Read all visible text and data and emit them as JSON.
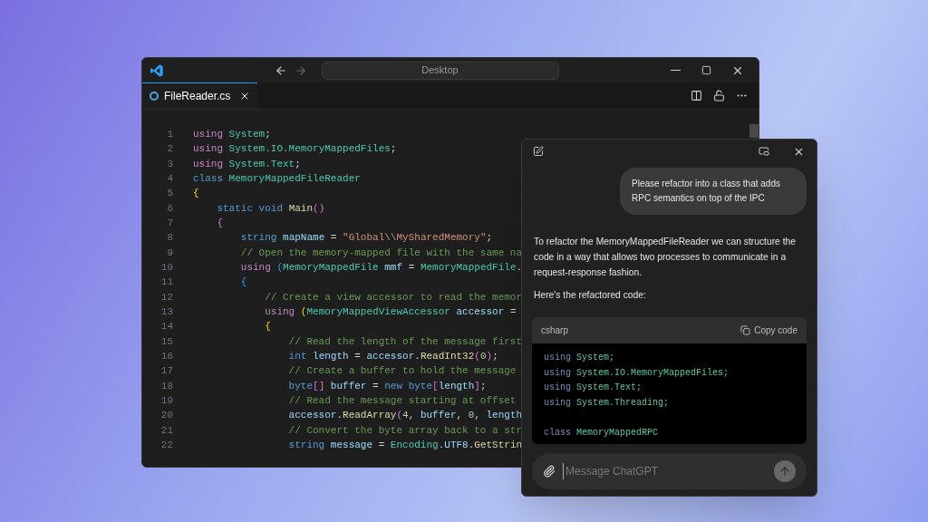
{
  "editor": {
    "title_bar": {
      "search": "Desktop",
      "back_disabled": false,
      "forward_disabled": true
    },
    "tabs": [
      {
        "label": "FileReader.cs",
        "selected": true
      }
    ],
    "code": [
      {
        "number": "1",
        "tokens": [
          {
            "text": "using ",
            "kind": "control"
          },
          {
            "text": "System",
            "kind": "type"
          },
          {
            "text": ";",
            "kind": "plain"
          }
        ]
      },
      {
        "number": "2",
        "tokens": [
          {
            "text": "using ",
            "kind": "control"
          },
          {
            "text": "System.IO.MemoryMappedFiles",
            "kind": "type"
          },
          {
            "text": ";",
            "kind": "plain"
          }
        ]
      },
      {
        "number": "3",
        "tokens": [
          {
            "text": "using ",
            "kind": "control"
          },
          {
            "text": "System.Text",
            "kind": "type"
          },
          {
            "text": ";",
            "kind": "plain"
          }
        ]
      },
      {
        "number": "4",
        "tokens": [
          {
            "text": "class ",
            "kind": "keyword"
          },
          {
            "text": "MemoryMappedFileReader",
            "kind": "type"
          }
        ]
      },
      {
        "number": "5",
        "tokens": [
          {
            "text": "{",
            "kind": "brace1"
          }
        ]
      },
      {
        "number": "6",
        "tokens": [
          {
            "text": "    static void ",
            "kind": "keyword"
          },
          {
            "text": "Main",
            "kind": "func"
          },
          {
            "text": "()",
            "kind": "brace2"
          }
        ]
      },
      {
        "number": "7",
        "tokens": [
          {
            "text": "    {",
            "kind": "brace2"
          }
        ]
      },
      {
        "number": "8",
        "tokens": [
          {
            "text": "        string ",
            "kind": "keyword"
          },
          {
            "text": "mapName",
            "kind": "var"
          },
          {
            "text": " = ",
            "kind": "plain"
          },
          {
            "text": "\"Global\\\\MySharedMemory\"",
            "kind": "string"
          },
          {
            "text": ";",
            "kind": "plain"
          }
        ]
      },
      {
        "number": "9",
        "tokens": [
          {
            "text": "        // Open the memory-mapped file with the same na",
            "kind": "comment"
          }
        ]
      },
      {
        "number": "10",
        "tokens": [
          {
            "text": "        using ",
            "kind": "control"
          },
          {
            "text": "(",
            "kind": "brace3"
          },
          {
            "text": "MemoryMappedFile ",
            "kind": "type"
          },
          {
            "text": "mmf",
            "kind": "var"
          },
          {
            "text": " = ",
            "kind": "plain"
          },
          {
            "text": "MemoryMappedFile",
            "kind": "type"
          },
          {
            "text": ".",
            "kind": "plain"
          }
        ]
      },
      {
        "number": "11",
        "tokens": [
          {
            "text": "        {",
            "kind": "brace3"
          }
        ]
      },
      {
        "number": "12",
        "tokens": [
          {
            "text": "            // Create a view accessor to read the memor",
            "kind": "comment"
          }
        ]
      },
      {
        "number": "13",
        "tokens": [
          {
            "text": "            using ",
            "kind": "control"
          },
          {
            "text": "(",
            "kind": "brace1"
          },
          {
            "text": "MemoryMappedViewAccessor ",
            "kind": "type"
          },
          {
            "text": "accessor",
            "kind": "var"
          },
          {
            "text": " =",
            "kind": "plain"
          }
        ]
      },
      {
        "number": "14",
        "tokens": [
          {
            "text": "            {",
            "kind": "brace1"
          }
        ]
      },
      {
        "number": "15",
        "tokens": [
          {
            "text": "                // Read the length of the message first",
            "kind": "comment"
          }
        ]
      },
      {
        "number": "16",
        "tokens": [
          {
            "text": "                int ",
            "kind": "keyword"
          },
          {
            "text": "length",
            "kind": "var"
          },
          {
            "text": " = ",
            "kind": "plain"
          },
          {
            "text": "accessor",
            "kind": "var"
          },
          {
            "text": ".",
            "kind": "plain"
          },
          {
            "text": "ReadInt32",
            "kind": "func"
          },
          {
            "text": "(",
            "kind": "brace2"
          },
          {
            "text": "0",
            "kind": "number"
          },
          {
            "text": ")",
            "kind": "brace2"
          },
          {
            "text": ";",
            "kind": "plain"
          }
        ]
      },
      {
        "number": "17",
        "tokens": [
          {
            "text": "                // Create a buffer to hold the message",
            "kind": "comment"
          }
        ]
      },
      {
        "number": "18",
        "tokens": [
          {
            "text": "                byte",
            "kind": "keyword"
          },
          {
            "text": "[]",
            "kind": "brace2"
          },
          {
            "text": " buffer",
            "kind": "var"
          },
          {
            "text": " = ",
            "kind": "plain"
          },
          {
            "text": "new byte",
            "kind": "keyword"
          },
          {
            "text": "[",
            "kind": "brace2"
          },
          {
            "text": "length",
            "kind": "var"
          },
          {
            "text": "]",
            "kind": "brace2"
          },
          {
            "text": ";",
            "kind": "plain"
          }
        ]
      },
      {
        "number": "19",
        "tokens": [
          {
            "text": "                // Read the message starting at offset",
            "kind": "comment"
          }
        ]
      },
      {
        "number": "20",
        "tokens": [
          {
            "text": "                accessor",
            "kind": "var"
          },
          {
            "text": ".",
            "kind": "plain"
          },
          {
            "text": "ReadArray",
            "kind": "func"
          },
          {
            "text": "(",
            "kind": "brace2"
          },
          {
            "text": "4",
            "kind": "number"
          },
          {
            "text": ", ",
            "kind": "plain"
          },
          {
            "text": "buffer",
            "kind": "var"
          },
          {
            "text": ", ",
            "kind": "plain"
          },
          {
            "text": "0",
            "kind": "number"
          },
          {
            "text": ", ",
            "kind": "plain"
          },
          {
            "text": "length",
            "kind": "var"
          }
        ]
      },
      {
        "number": "21",
        "tokens": [
          {
            "text": "                // Convert the byte array back to a str",
            "kind": "comment"
          }
        ]
      },
      {
        "number": "22",
        "tokens": [
          {
            "text": "                string ",
            "kind": "keyword"
          },
          {
            "text": "message",
            "kind": "var"
          },
          {
            "text": " = ",
            "kind": "plain"
          },
          {
            "text": "Encoding",
            "kind": "type"
          },
          {
            "text": ".",
            "kind": "plain"
          },
          {
            "text": "UTF8",
            "kind": "var"
          },
          {
            "text": ".",
            "kind": "plain"
          },
          {
            "text": "GetStrin",
            "kind": "func"
          }
        ]
      }
    ]
  },
  "chat": {
    "user_message": {
      "paragraphs": [
        "Please refactor into a class that adds RPC semantics on top of the IPC"
      ]
    },
    "assistant_message": {
      "paragraphs": [
        "To refactor the MemoryMappedFileReader we can structure the code in a way that allows two processes to communicate in a request-response fashion.",
        "Here's the refactored code:"
      ],
      "code_block": {
        "language": "csharp",
        "copy_label": "Copy code",
        "sections": [
          [
            {
              "tokens": [
                {
                  "text": "using ",
                  "kind": "keyword"
                },
                {
                  "text": "System;",
                  "kind": "type"
                }
              ]
            },
            {
              "tokens": [
                {
                  "text": "using ",
                  "kind": "keyword"
                },
                {
                  "text": "System.IO.MemoryMappedFiles;",
                  "kind": "type"
                }
              ]
            },
            {
              "tokens": [
                {
                  "text": "using ",
                  "kind": "keyword"
                },
                {
                  "text": "System.Text;",
                  "kind": "type"
                }
              ]
            },
            {
              "tokens": [
                {
                  "text": "using ",
                  "kind": "keyword"
                },
                {
                  "text": "System.Threading;",
                  "kind": "type"
                }
              ]
            }
          ],
          [
            {
              "tokens": [
                {
                  "text": "class ",
                  "kind": "keyword"
                },
                {
                  "text": "MemoryMappedRPC",
                  "kind": "type"
                }
              ]
            }
          ]
        ]
      }
    },
    "input": {
      "placeholder": "Message ChatGPT",
      "send_disabled": true
    }
  }
}
